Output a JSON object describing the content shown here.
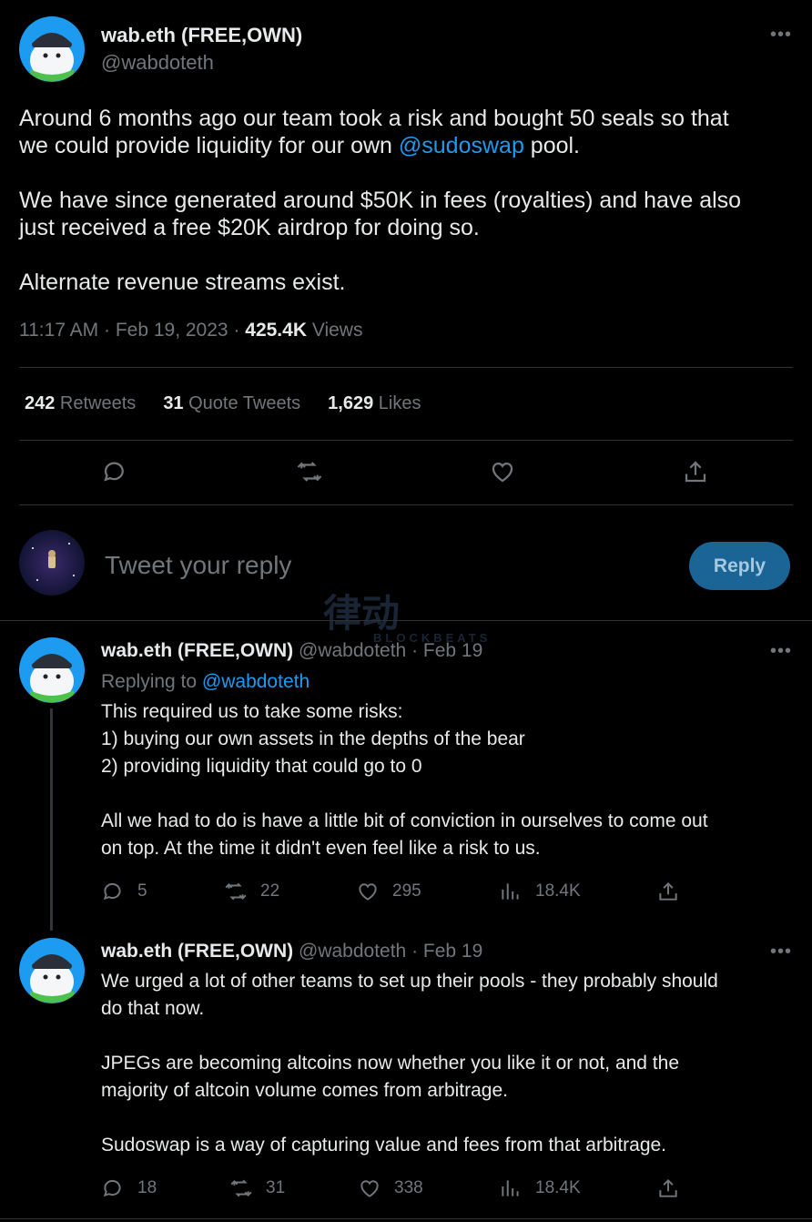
{
  "main_tweet": {
    "display_name": "wab.eth (FREE,OWN)",
    "handle": "@wabdoteth",
    "line1_pre": "Around 6 months ago our team took a risk and bought 50 seals so that",
    "line2_pre": "we could provide liquidity for our own ",
    "mention": "@sudoswap",
    "line2_post": " pool.",
    "para2": "We have since generated around $50K in fees (royalties) and have also\njust received a free $20K airdrop for doing so.",
    "para3": "Alternate revenue streams exist.",
    "time": "11:17 AM · Feb 19, 2023 · ",
    "views_count": "425.4K",
    "views_label": " Views",
    "retweets_count": "242",
    "retweets_label": " Retweets",
    "quotes_count": "31",
    "quotes_label": " Quote Tweets",
    "likes_count": "1,629",
    "likes_label": " Likes"
  },
  "composer": {
    "placeholder": "Tweet your reply",
    "button": "Reply"
  },
  "watermark": {
    "main": "律动",
    "sub": "BLOCKBEATS"
  },
  "replies": [
    {
      "display_name": "wab.eth (FREE,OWN)",
      "handle_date": " @wabdoteth · Feb 19",
      "replying_label": "Replying to ",
      "replying_to": "@wabdoteth",
      "text": "This required us to take some risks:\n1) buying our own assets in the depths of the bear\n2) providing liquidity that could go to 0\n\nAll we had to do is have a little bit of conviction in ourselves to come out\non top. At the time it didn't even feel like a risk to us.",
      "replies": "5",
      "retweets": "22",
      "likes": "295",
      "views": "18.4K"
    },
    {
      "display_name": "wab.eth (FREE,OWN)",
      "handle_date": " @wabdoteth · Feb 19",
      "text": "We urged a lot of other teams to set up their pools - they probably should\ndo that now.\n\nJPEGs are becoming altcoins now whether you like it or not, and the\nmajority of altcoin volume comes from arbitrage.\n\nSudoswap is a way of capturing value and fees from that arbitrage.",
      "replies": "18",
      "retweets": "31",
      "likes": "338",
      "views": "18.4K"
    }
  ],
  "colors": {
    "background": "#000000",
    "text": "#e7e9ea",
    "muted": "#71767b",
    "link": "#1d9bf0",
    "divider": "#2f3336"
  }
}
